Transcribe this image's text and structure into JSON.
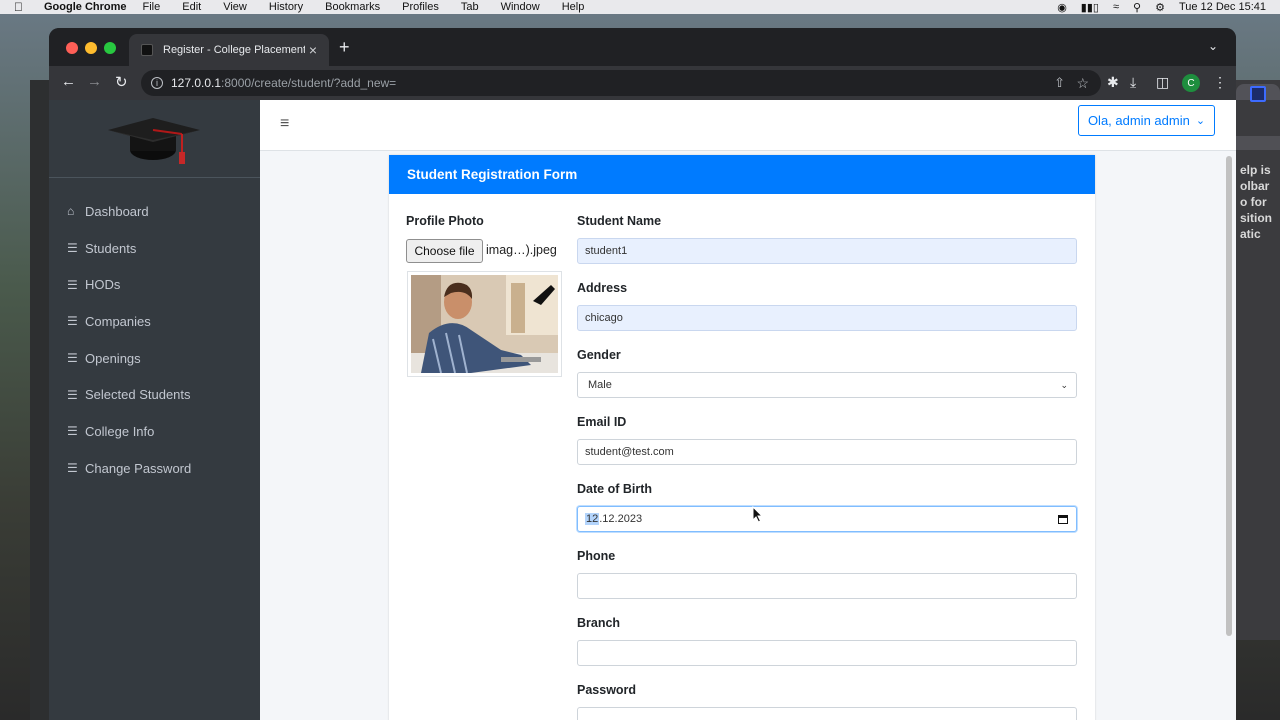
{
  "menubar": {
    "app": "Google Chrome",
    "items": [
      "File",
      "Edit",
      "View",
      "History",
      "Bookmarks",
      "Profiles",
      "Tab",
      "Window",
      "Help"
    ],
    "datetime": "Tue 12 Dec  15:41"
  },
  "background_app": {
    "lines": [
      "elp is",
      "olbar",
      "o for",
      "sition",
      "atic"
    ]
  },
  "browser": {
    "tab_title": "Register - College Placement",
    "url_host": "127.0.0.1",
    "url_path": ":8000/create/student/?add_new=",
    "profile_initial": "C"
  },
  "sidebar": {
    "items": [
      {
        "label": "Dashboard",
        "icon": "home-icon"
      },
      {
        "label": "Students",
        "icon": "list-icon"
      },
      {
        "label": "HODs",
        "icon": "list-icon"
      },
      {
        "label": "Companies",
        "icon": "list-icon"
      },
      {
        "label": "Openings",
        "icon": "list-icon"
      },
      {
        "label": "Selected Students",
        "icon": "list-icon"
      },
      {
        "label": "College Info",
        "icon": "list-icon"
      },
      {
        "label": "Change Password",
        "icon": "list-icon"
      }
    ]
  },
  "navbar": {
    "user": "Ola, admin admin"
  },
  "form": {
    "title": "Student Registration Form",
    "photo": {
      "label": "Profile Photo",
      "button": "Choose file",
      "filename": "imag…).jpeg"
    },
    "fields": {
      "name": {
        "label": "Student Name",
        "value": "student1"
      },
      "address": {
        "label": "Address",
        "value": "chicago"
      },
      "gender": {
        "label": "Gender",
        "value": "Male"
      },
      "email": {
        "label": "Email ID",
        "value": "student@test.com"
      },
      "dob": {
        "label": "Date of Birth",
        "day": "12",
        "rest": ".12.2023"
      },
      "phone": {
        "label": "Phone",
        "value": ""
      },
      "branch": {
        "label": "Branch",
        "value": ""
      },
      "password": {
        "label": "Password",
        "value": ""
      }
    }
  },
  "colors": {
    "primary": "#007bff",
    "sidebar": "#343a40",
    "autofill": "#e8f0fe"
  }
}
